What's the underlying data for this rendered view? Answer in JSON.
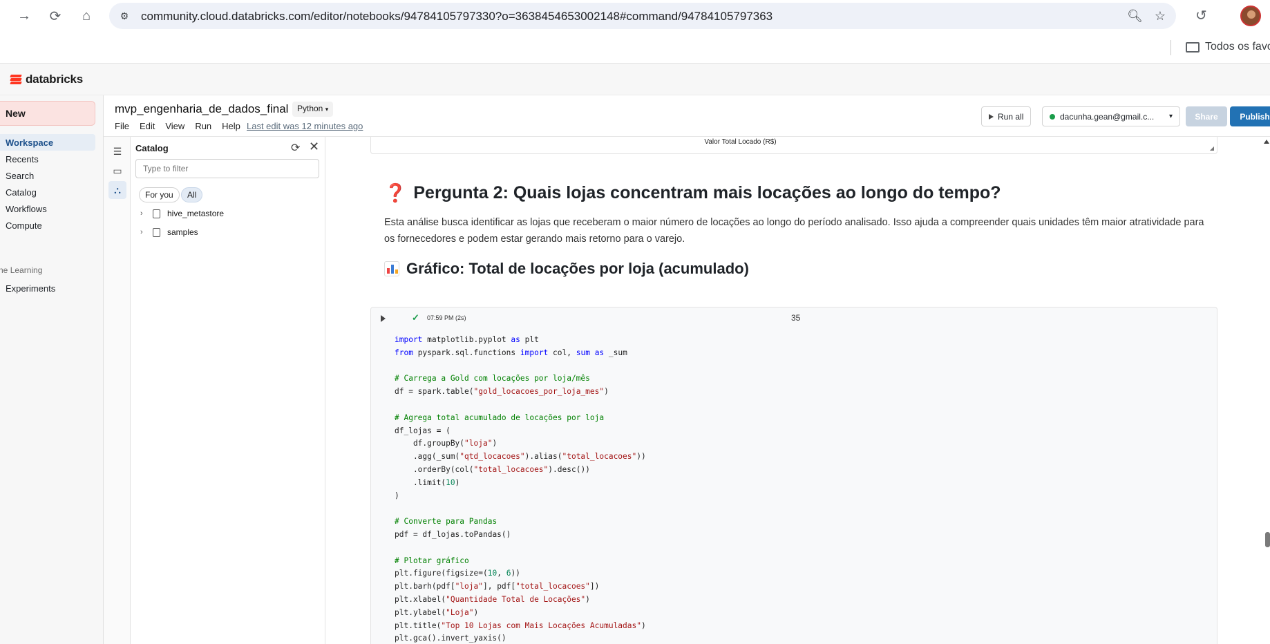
{
  "browser": {
    "url": "community.cloud.databricks.com/editor/notebooks/94784105797330?o=3638454653002148#command/94784105797363",
    "bookmarks_folder": "Todos os favoritos"
  },
  "app": {
    "brand": "databricks"
  },
  "left_nav": {
    "new_label": "New",
    "items": [
      {
        "label": "Workspace",
        "active": true
      },
      {
        "label": "Recents"
      },
      {
        "label": "Search"
      },
      {
        "label": "Catalog"
      },
      {
        "label": "Workflows"
      },
      {
        "label": "Compute"
      }
    ],
    "section_ml": "Machine Learning",
    "ml_items": [
      {
        "label": "Experiments"
      }
    ]
  },
  "notebook": {
    "title": "mvp_engenharia_de_dados_final",
    "language": "Python",
    "menu": [
      "File",
      "Edit",
      "View",
      "Run",
      "Help"
    ],
    "last_edit": "Last edit was 12 minutes ago",
    "run_all": "Run all",
    "compute": "dacunha.gean@gmail.c...",
    "share": "Share",
    "publish": "Publish"
  },
  "catalog": {
    "title": "Catalog",
    "filter_placeholder": "Type to filter",
    "chips": [
      "For you",
      "All"
    ],
    "tree": [
      "hive_metastore",
      "samples"
    ]
  },
  "content": {
    "prev_chart_label": "Valor Total Locado (R$)",
    "question_title": "Pergunta 2: Quais lojas concentram mais locações ao longo do tempo?",
    "question_text": "Esta análise busca identificar as lojas que receberam o maior número de locações ao longo do período analisado. Isso ajuda a compreender quais unidades têm maior atratividade para os fornecedores e podem estar gerando mais retorno para o varejo.",
    "chart_heading": "Gráfico: Total de locações por loja (acumulado)",
    "cell": {
      "status_time": "07:59 PM (2s)",
      "number": "35"
    }
  },
  "colors": {
    "brand": "#ff3621",
    "publish": "#2272b4",
    "nav_active": "#e6edf5",
    "new_button": "#fbe3e1"
  }
}
